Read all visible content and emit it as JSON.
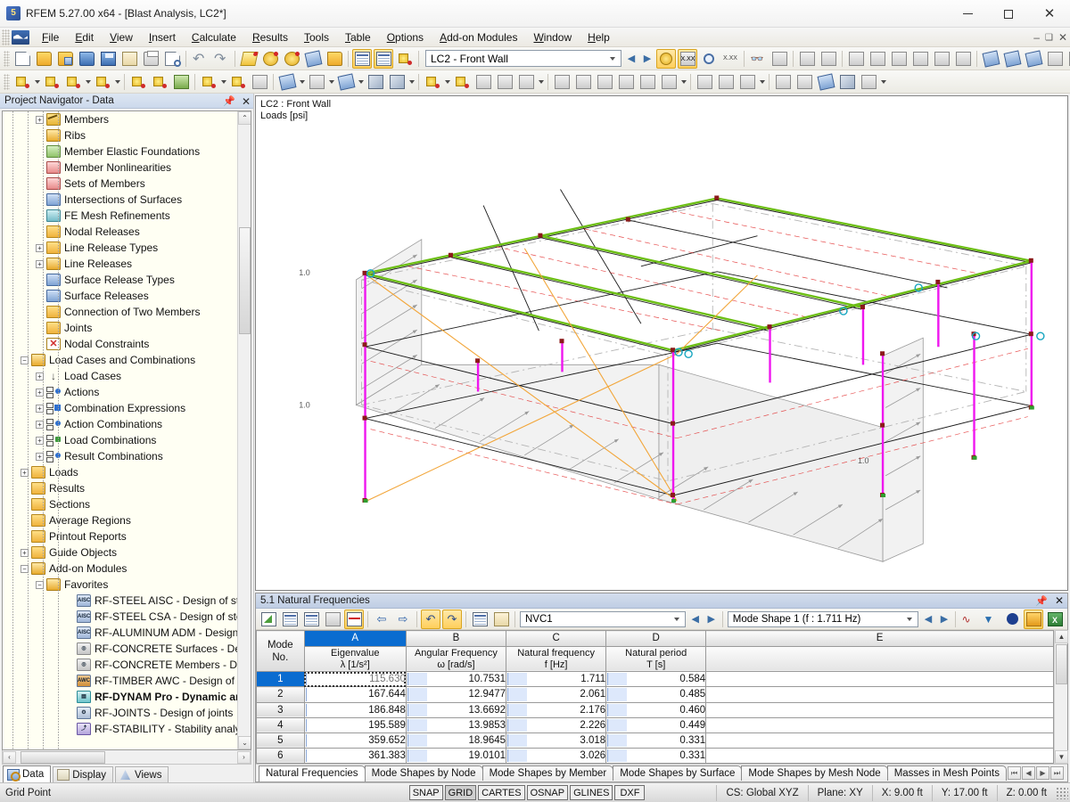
{
  "window": {
    "title": "RFEM 5.27.00 x64 - [Blast Analysis, LC2*]",
    "minimize": "—",
    "maximize": "☐",
    "close": "✕"
  },
  "menu": {
    "items": [
      "File",
      "Edit",
      "View",
      "Insert",
      "Calculate",
      "Results",
      "Tools",
      "Table",
      "Options",
      "Add-on Modules",
      "Window",
      "Help"
    ],
    "right_glyphs": [
      "–",
      "❐",
      "✕"
    ]
  },
  "toolbar_main": {
    "load_case_value": "LC2 - Front Wall",
    "icons": [
      "new-document-icon",
      "open-folder-icon",
      "open-model-icon",
      "save-as-icon",
      "save-icon",
      "clipboard-icon",
      "print-icon",
      "print-preview-icon",
      "undo-icon",
      "redo-icon",
      "render-icon",
      "lighting-icon",
      "sun-icon",
      "select-add-icon",
      "window-icon",
      "table-icon",
      "table-alt-icon",
      "export-down-icon"
    ],
    "nav_prev": "◀",
    "nav_next": "▶",
    "right_icons": [
      "loads-icon",
      "loads-value-icon",
      "view-loads-icon",
      "value-icon",
      "glasses-icon",
      "measure-icon",
      "grid-icon",
      "grid-dots-icon",
      "rotate-view-icon",
      "rotate-x-icon",
      "rotate-y-icon",
      "mesh-icon",
      "perspective-icon",
      "angle-icon",
      "mirror-axis-icon",
      "mirror-icon",
      "cross-snap-icon",
      "info-icon",
      "clipboard2-icon",
      "excel-icon"
    ]
  },
  "toolbar_second": {
    "icons": [
      "new-node-icon",
      "new-line-icon",
      "new-dimension-icon",
      "new-polygon-icon",
      "new-support-icon",
      "new-support-line-icon",
      "new-surface-icon",
      "new-member-icon",
      "new-member-xx-icon",
      "mesh-refine-icon",
      "new-solid-icon",
      "new-opening-icon",
      "new-rib-icon",
      "new-block-icon",
      "new-copy-icon",
      "loads-nodal-icon",
      "loads-member-icon",
      "loads-surface-icon",
      "loads-free-icon",
      "loads-generate-icon",
      "calc-icon",
      "results-icon",
      "deform-icon",
      "print-report-icon",
      "graphic-icon",
      "result-diagram-icon",
      "iso-icon",
      "export2-icon",
      "filter-icon",
      "visibility-icon",
      "plane-icon",
      "clip-icon",
      "render2-icon",
      "views-icon"
    ]
  },
  "navigator": {
    "header": "Project Navigator - Data",
    "pin_icon": "pin-icon",
    "close_icon": "close-icon",
    "tree": [
      {
        "label": "Members",
        "indent": 3,
        "expander": "+",
        "icon": "memb",
        "bold": false
      },
      {
        "label": "Ribs",
        "indent": 3,
        "expander": "",
        "icon": "folder-open",
        "bold": false
      },
      {
        "label": "Member Elastic Foundations",
        "indent": 3,
        "expander": "",
        "icon": "sq-green",
        "bold": false
      },
      {
        "label": "Member Nonlinearities",
        "indent": 3,
        "expander": "",
        "icon": "sq-red",
        "bold": false
      },
      {
        "label": "Sets of Members",
        "indent": 3,
        "expander": "",
        "icon": "sq-red",
        "bold": false
      },
      {
        "label": "Intersections of Surfaces",
        "indent": 3,
        "expander": "",
        "icon": "sq-blue",
        "bold": false
      },
      {
        "label": "FE Mesh Refinements",
        "indent": 3,
        "expander": "",
        "icon": "sq-teal",
        "bold": false
      },
      {
        "label": "Nodal Releases",
        "indent": 3,
        "expander": "",
        "icon": "folder",
        "bold": false
      },
      {
        "label": "Line Release Types",
        "indent": 3,
        "expander": "+",
        "icon": "folder",
        "bold": false
      },
      {
        "label": "Line Releases",
        "indent": 3,
        "expander": "+",
        "icon": "folder-open",
        "bold": false
      },
      {
        "label": "Surface Release Types",
        "indent": 3,
        "expander": "",
        "icon": "sq-blue",
        "bold": false
      },
      {
        "label": "Surface Releases",
        "indent": 3,
        "expander": "",
        "icon": "sq-blue",
        "bold": false
      },
      {
        "label": "Connection of Two Members",
        "indent": 3,
        "expander": "",
        "icon": "folder",
        "bold": false
      },
      {
        "label": "Joints",
        "indent": 3,
        "expander": "",
        "icon": "folder",
        "bold": false
      },
      {
        "label": "Nodal Constraints",
        "indent": 3,
        "expander": "",
        "icon": "xred",
        "bold": false
      },
      {
        "label": "Load Cases and Combinations",
        "indent": 2,
        "expander": "−",
        "icon": "folder-open",
        "bold": false
      },
      {
        "label": "Load Cases",
        "indent": 3,
        "expander": "+",
        "icon": "load",
        "bold": false
      },
      {
        "label": "Actions",
        "indent": 3,
        "expander": "+",
        "icon": "combo",
        "bold": false
      },
      {
        "label": "Combination Expressions",
        "indent": 3,
        "expander": "+",
        "icon": "combo-bar",
        "bold": false
      },
      {
        "label": "Action Combinations",
        "indent": 3,
        "expander": "+",
        "icon": "combo",
        "bold": false
      },
      {
        "label": "Load Combinations",
        "indent": 3,
        "expander": "+",
        "icon": "combo-green",
        "bold": false
      },
      {
        "label": "Result Combinations",
        "indent": 3,
        "expander": "+",
        "icon": "combo",
        "bold": false
      },
      {
        "label": "Loads",
        "indent": 2,
        "expander": "+",
        "icon": "folder",
        "bold": false
      },
      {
        "label": "Results",
        "indent": 2,
        "expander": "",
        "icon": "folder",
        "bold": false
      },
      {
        "label": "Sections",
        "indent": 2,
        "expander": "",
        "icon": "folder",
        "bold": false
      },
      {
        "label": "Average Regions",
        "indent": 2,
        "expander": "",
        "icon": "folder",
        "bold": false
      },
      {
        "label": "Printout Reports",
        "indent": 2,
        "expander": "",
        "icon": "folder",
        "bold": false
      },
      {
        "label": "Guide Objects",
        "indent": 2,
        "expander": "+",
        "icon": "folder",
        "bold": false
      },
      {
        "label": "Add-on Modules",
        "indent": 2,
        "expander": "−",
        "icon": "folder-open",
        "bold": false
      },
      {
        "label": "Favorites",
        "indent": 3,
        "expander": "−",
        "icon": "folder-open",
        "bold": false
      },
      {
        "label": "RF-STEEL AISC - Design of stee",
        "indent": 5,
        "expander": "",
        "icon": "mod-aisc",
        "bold": false
      },
      {
        "label": "RF-STEEL CSA - Design of steel",
        "indent": 5,
        "expander": "",
        "icon": "mod-aisc",
        "bold": false
      },
      {
        "label": "RF-ALUMINUM ADM - Design",
        "indent": 5,
        "expander": "",
        "icon": "mod-aisc",
        "bold": false
      },
      {
        "label": "RF-CONCRETE Surfaces - Desig",
        "indent": 5,
        "expander": "",
        "icon": "mod-conc",
        "bold": false
      },
      {
        "label": "RF-CONCRETE Members - Des",
        "indent": 5,
        "expander": "",
        "icon": "mod-conc",
        "bold": false
      },
      {
        "label": "RF-TIMBER AWC - Design of ti",
        "indent": 5,
        "expander": "",
        "icon": "mod-timber",
        "bold": false
      },
      {
        "label": "RF-DYNAM Pro - Dynamic an",
        "indent": 5,
        "expander": "",
        "icon": "mod-dynam",
        "bold": true
      },
      {
        "label": "RF-JOINTS - Design of joints",
        "indent": 5,
        "expander": "",
        "icon": "mod-joints",
        "bold": false
      },
      {
        "label": "RF-STABILITY - Stability analys",
        "indent": 5,
        "expander": "",
        "icon": "mod-stab",
        "bold": false
      }
    ],
    "scroll_up": "⌃",
    "scroll_down": "⌄",
    "scroll_left": "‹",
    "scroll_right": "›",
    "tabs": [
      {
        "label": "Data",
        "icon": "data-icon",
        "active": true
      },
      {
        "label": "Display",
        "icon": "display-icon",
        "active": false
      },
      {
        "label": "Views",
        "icon": "views-icon",
        "active": false
      }
    ]
  },
  "viewport": {
    "label_line1": "LC2 : Front Wall",
    "label_line2": "Loads [psi]",
    "load_value_labels": [
      "1.0",
      "1.0",
      "1.0",
      "1.0"
    ]
  },
  "table_panel": {
    "title": "5.1 Natural Frequencies",
    "pin_icon": "pin-icon",
    "close_icon": "close-icon",
    "toolbar_icons": [
      "edit-table-icon",
      "insert-row-icon",
      "fill-down-icon",
      "chart-icon",
      "results-diagram-icon",
      "prev-column-icon",
      "next-column-icon",
      "rotate-left-icon",
      "rotate-right-icon",
      "table-settings-icon",
      "table-edit-icon"
    ],
    "case_selector": "NVC1",
    "case_prev": "◀",
    "case_next": "▶",
    "mode_selector": "Mode Shape 1 (f : 1.711 Hz)",
    "mode_prev": "◀",
    "mode_next": "▶",
    "right_icons": [
      "diagram-icon",
      "filter-icon",
      "info2-icon",
      "report-icon",
      "excel-export-icon"
    ],
    "tabs": [
      {
        "label": "Natural Frequencies",
        "active": true
      },
      {
        "label": "Mode Shapes by Node",
        "active": false
      },
      {
        "label": "Mode Shapes by Member",
        "active": false
      },
      {
        "label": "Mode Shapes by Surface",
        "active": false
      },
      {
        "label": "Mode Shapes by Mesh Node",
        "active": false
      },
      {
        "label": "Masses in Mesh Points",
        "active": false
      }
    ],
    "tab_nav": [
      "⏮",
      "◀",
      "▶",
      "⏭"
    ]
  },
  "chart_data": {
    "type": "table",
    "title": "5.1 Natural Frequencies",
    "column_letters": [
      "A",
      "B",
      "C",
      "D",
      "E"
    ],
    "row_header": {
      "line1": "Mode",
      "line2": "No."
    },
    "columns": [
      {
        "letter": "A",
        "name": "Eigenvalue",
        "symbol": "λ [1/s²]",
        "selected": true
      },
      {
        "letter": "B",
        "name": "Angular Frequency",
        "symbol": "ω [rad/s]",
        "selected": false
      },
      {
        "letter": "C",
        "name": "Natural frequency",
        "symbol": "f [Hz]",
        "selected": false
      },
      {
        "letter": "D",
        "name": "Natural period",
        "symbol": "T [s]",
        "selected": false
      },
      {
        "letter": "E",
        "name": "",
        "symbol": "",
        "selected": false
      }
    ],
    "rows": [
      {
        "mode": "1",
        "eigenvalue": "115.630",
        "angular_frequency": "10.7531",
        "natural_frequency": "1.711",
        "natural_period": "0.584",
        "selected": true
      },
      {
        "mode": "2",
        "eigenvalue": "167.644",
        "angular_frequency": "12.9477",
        "natural_frequency": "2.061",
        "natural_period": "0.485",
        "selected": false
      },
      {
        "mode": "3",
        "eigenvalue": "186.848",
        "angular_frequency": "13.6692",
        "natural_frequency": "2.176",
        "natural_period": "0.460",
        "selected": false
      },
      {
        "mode": "4",
        "eigenvalue": "195.589",
        "angular_frequency": "13.9853",
        "natural_frequency": "2.226",
        "natural_period": "0.449",
        "selected": false
      },
      {
        "mode": "5",
        "eigenvalue": "359.652",
        "angular_frequency": "18.9645",
        "natural_frequency": "3.018",
        "natural_period": "0.331",
        "selected": false
      },
      {
        "mode": "6",
        "eigenvalue": "361.383",
        "angular_frequency": "19.0101",
        "natural_frequency": "3.026",
        "natural_period": "0.331",
        "selected": false
      }
    ]
  },
  "statusbar": {
    "message": "Grid Point",
    "flags": [
      {
        "label": "SNAP",
        "on": false
      },
      {
        "label": "GRID",
        "on": true
      },
      {
        "label": "CARTES",
        "on": false
      },
      {
        "label": "OSNAP",
        "on": false
      },
      {
        "label": "GLINES",
        "on": false
      },
      {
        "label": "DXF",
        "on": false
      }
    ],
    "cs": "CS: Global XYZ",
    "plane": "Plane: XY",
    "x": "X:  9.00 ft",
    "y": "Y:  17.00 ft",
    "z": "Z:  0.00 ft"
  },
  "colors": {
    "accent_blue": "#0a6cd0",
    "member_magenta": "#e800e8",
    "beam_green": "#66b800",
    "load_gray": "#8a8a8a",
    "orange_cable": "#f0a830",
    "node_dark_red": "#8b1a1a"
  }
}
